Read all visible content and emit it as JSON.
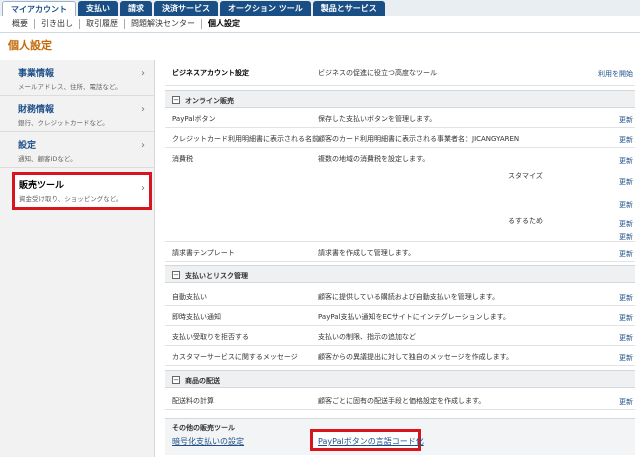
{
  "top_tabs": [
    "マイアカウント",
    "支払い",
    "請求",
    "決済サービス",
    "オークション ツール",
    "製品とサービス"
  ],
  "sub_nav": [
    "概要",
    "引き出し",
    "取引履歴",
    "問題解決センター",
    "個人設定"
  ],
  "page_title": "個人設定",
  "sidebar": [
    {
      "title": "事業情報",
      "sub": "メールアドレス、住所、電話など。"
    },
    {
      "title": "財務情報",
      "sub": "銀行、クレジットカードなど。"
    },
    {
      "title": "設定",
      "sub": "通知、顧客IDなど。"
    },
    {
      "title": "販売ツール",
      "sub": "資金受け取り、ショッピングなど。"
    }
  ],
  "business_account": {
    "name": "ビジネスアカウント設定",
    "desc": "ビジネスの促進に役立つ高度なツール",
    "action": "利用を開始"
  },
  "online_sales": {
    "section": "オンライン販売",
    "rows": [
      {
        "name": "PayPalボタン",
        "desc": "保存した支払いボタンを管理します。",
        "action": "更新"
      },
      {
        "name": "クレジットカード利用明細書に表示される名前",
        "desc": "顧客のカード利用明細書に表示される事業者名：JICANGYAREN",
        "action": "更新"
      },
      {
        "name": "消費税",
        "desc": "複数の地域の消費税を設定します。",
        "action": "更新"
      },
      {
        "name": "",
        "desc": "",
        "action": "更新"
      },
      {
        "name": "",
        "desc": "",
        "action": "更新"
      },
      {
        "name": "",
        "desc": "",
        "action": "更新"
      },
      {
        "name": "",
        "desc": "",
        "action": "更新"
      },
      {
        "name": "請求書テンプレート",
        "desc": "請求書を作成して管理します。",
        "action": "更新"
      }
    ],
    "fragment1": "スタマイズ",
    "fragment2": "るするため"
  },
  "payment_risk": {
    "section": "支払いとリスク管理",
    "rows": [
      {
        "name": "自動支払い",
        "desc": "顧客に提供している購読および自動支払いを管理します。",
        "action": "更新"
      },
      {
        "name": "即時支払い通知",
        "desc": "PayPal支払い通知をECサイトにインテグレーションします。",
        "action": "更新"
      },
      {
        "name": "支払い受取りを拒否する",
        "desc": "支払いの制限、指示の追加など",
        "action": "更新"
      },
      {
        "name": "カスタマーサービスに関するメッセージ",
        "desc": "顧客からの異議提出に対して独自のメッセージを作成します。",
        "action": "更新"
      }
    ]
  },
  "shipping": {
    "section": "商品の配送",
    "rows": [
      {
        "name": "配送料の計算",
        "desc": "顧客ごとに固有の配送手段と価格設定を作成します。",
        "action": "更新"
      }
    ]
  },
  "other_tools": {
    "title": "その他の販売ツール",
    "link1": "暗号化支払いの設定",
    "link2": "PayPalボタンの言語コード化"
  }
}
